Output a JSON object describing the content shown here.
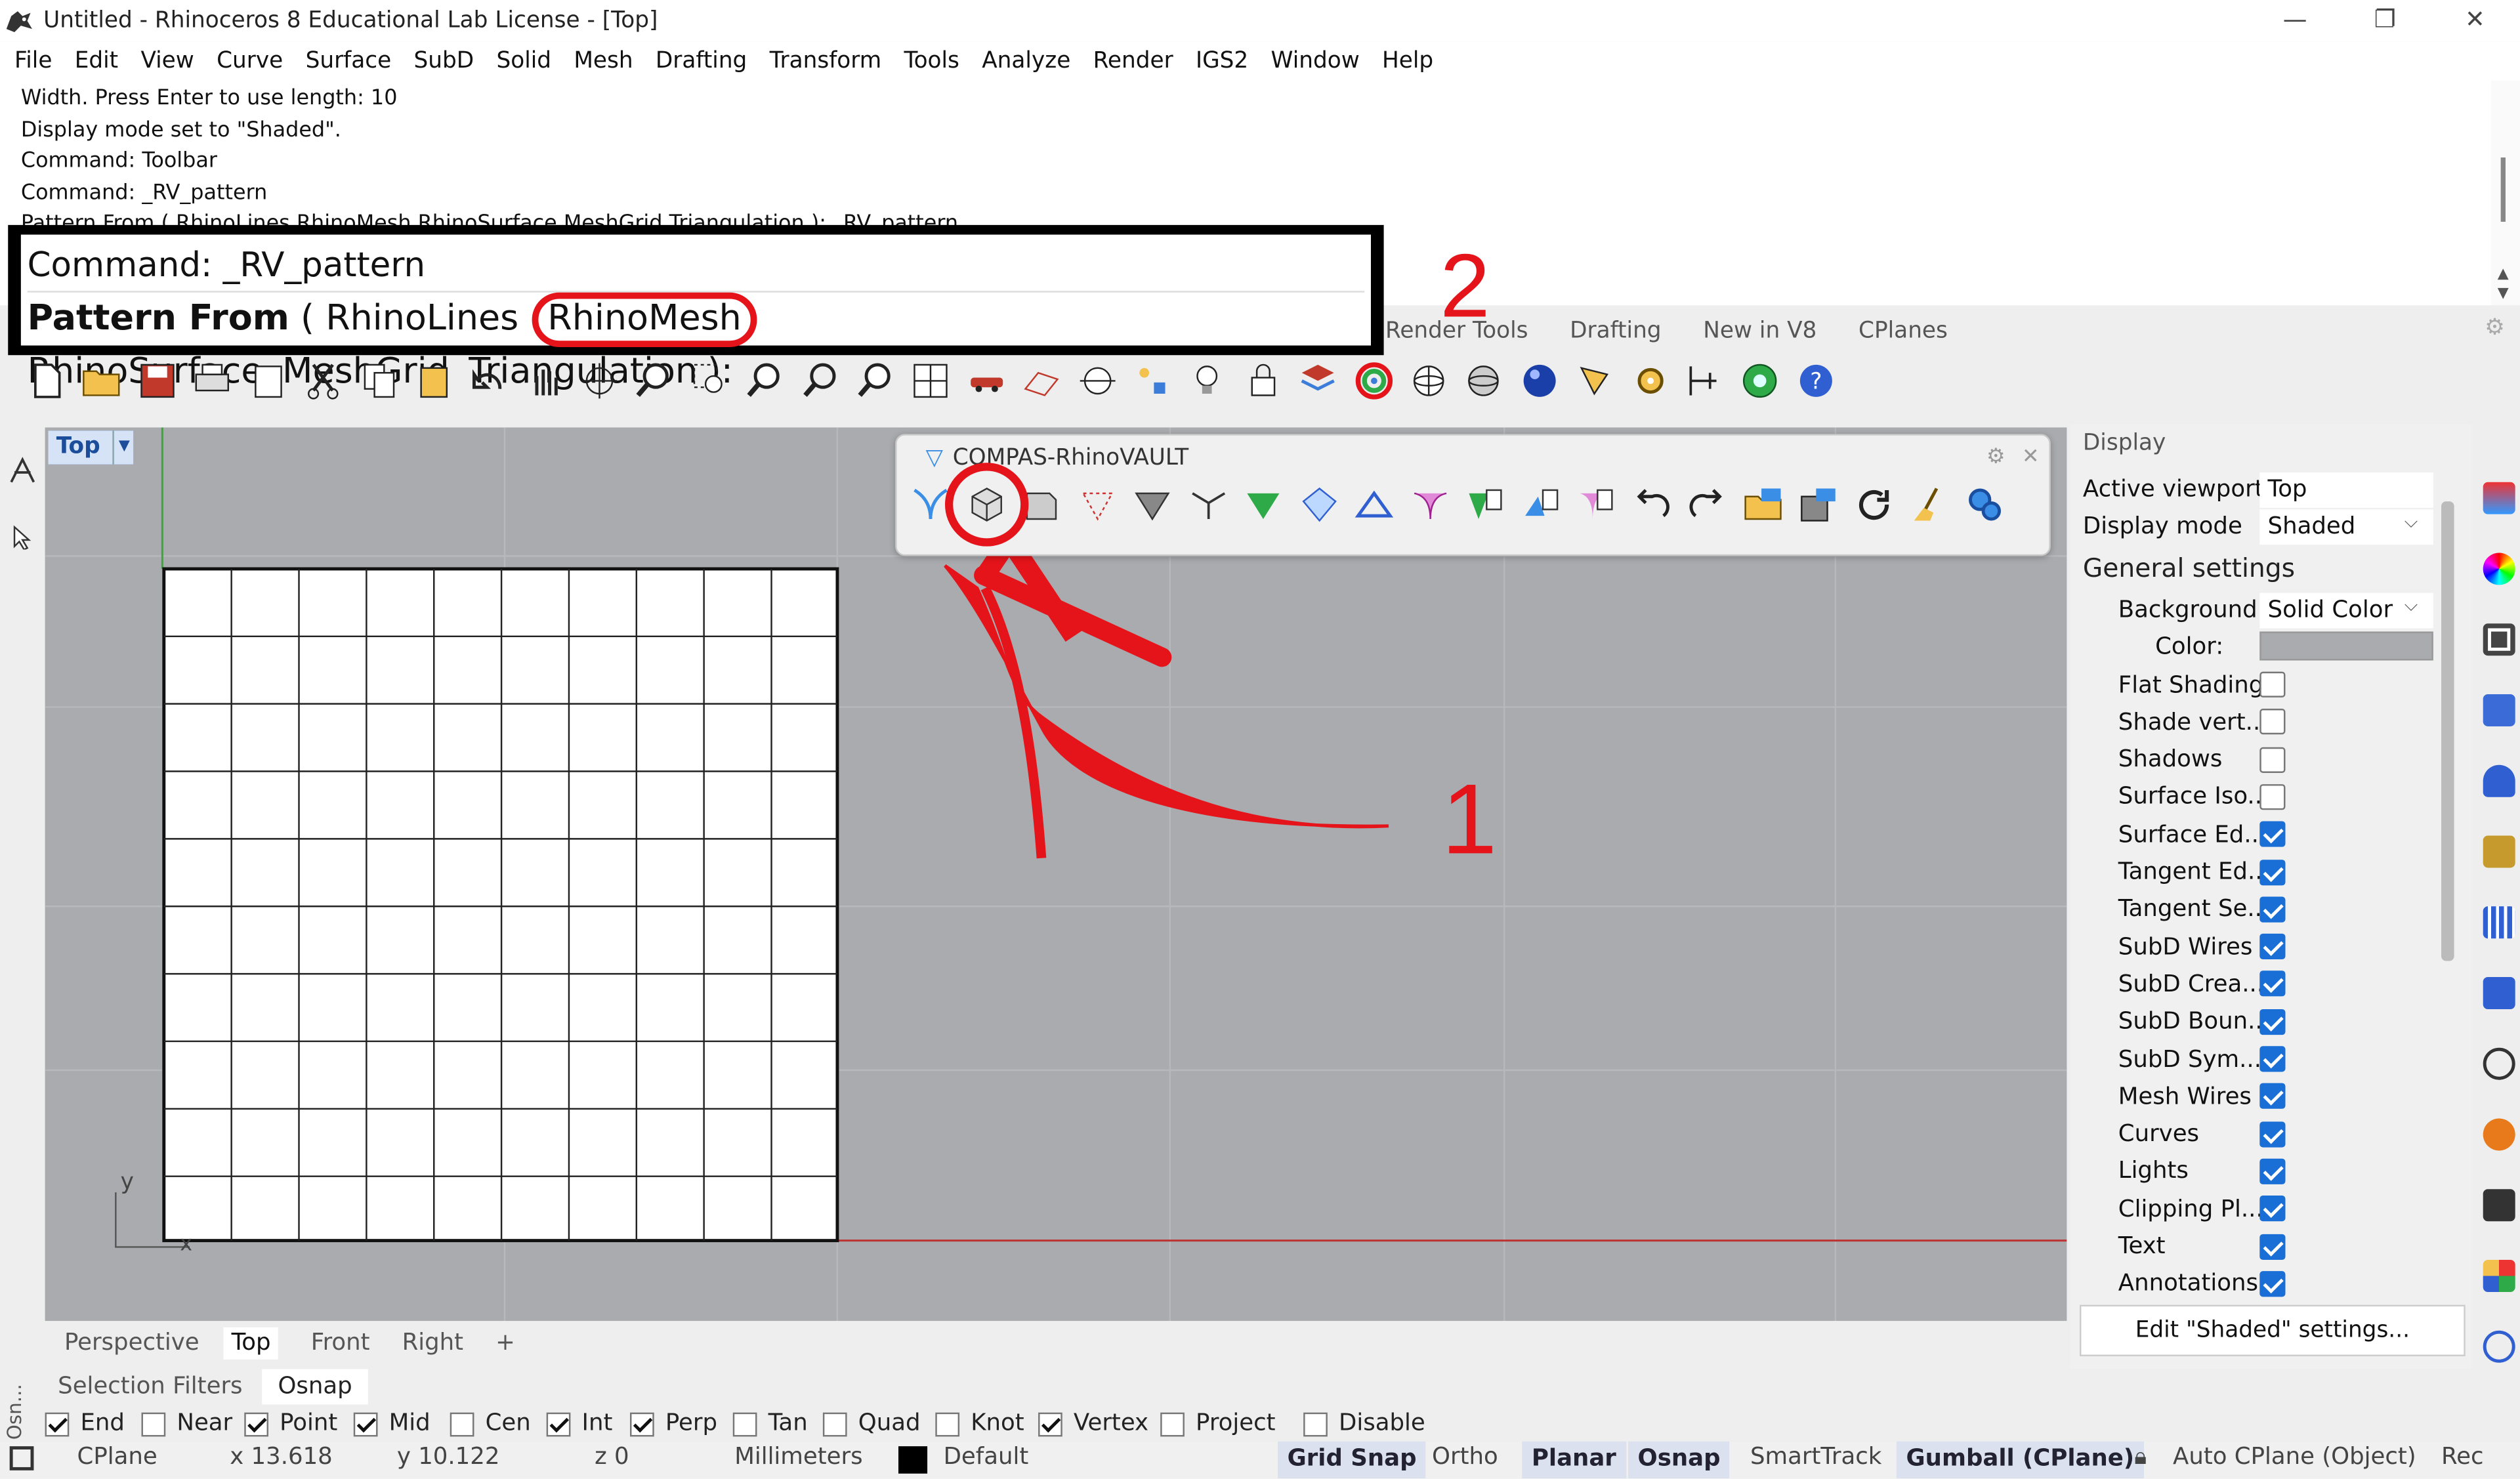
{
  "window": {
    "title": "Untitled - Rhinoceros 8 Educational Lab License - [Top]",
    "minimize": "—",
    "restore": "❐",
    "close": "✕"
  },
  "menu": [
    "File",
    "Edit",
    "View",
    "Curve",
    "Surface",
    "SubD",
    "Solid",
    "Mesh",
    "Drafting",
    "Transform",
    "Tools",
    "Analyze",
    "Render",
    "IGS2",
    "Window",
    "Help"
  ],
  "history": [
    "Width. Press Enter to use length: 10",
    "Display mode set to \"Shaded\".",
    "Command: Toolbar",
    "Command: _RV_pattern",
    "Pattern From ( RhinoLines  RhinoMesh  RhinoSurface  MeshGrid  Triangulation ):  _RV_pattern"
  ],
  "command": {
    "line1": "Command: _RV_pattern",
    "prompt_bold": "Pattern From",
    "paren_open": "(",
    "options": [
      "RhinoLines",
      "RhinoMesh",
      "RhinoSurface",
      "MeshGrid",
      "Triangulation"
    ],
    "suffix": "):"
  },
  "annotations": {
    "step1": "1",
    "step2": "2",
    "color": "#e5141b"
  },
  "toolbar_tabs": [
    "Render Tools",
    "Drafting",
    "New in V8",
    "CPlanes"
  ],
  "viewport": {
    "name": "Top",
    "axis_y": "y",
    "axis_x": "x",
    "grid_color": "#b8babd",
    "bg": "#a9abae"
  },
  "rhinovault": {
    "title": "COMPAS-RhinoVAULT"
  },
  "display_panel": {
    "header": "Display",
    "active_viewport_label": "Active viewport",
    "active_viewport": "Top",
    "display_mode_label": "Display mode",
    "display_mode": "Shaded",
    "general_settings": "General settings",
    "background_label": "Background",
    "background": "Solid Color",
    "color_label": "Color:",
    "settings": [
      {
        "label": "Flat Shading",
        "checked": false
      },
      {
        "label": "Shade vert...",
        "checked": false
      },
      {
        "label": "Shadows",
        "checked": false
      },
      {
        "label": "Surface Iso...",
        "checked": false
      },
      {
        "label": "Surface Ed...",
        "checked": true
      },
      {
        "label": "Tangent Ed...",
        "checked": true
      },
      {
        "label": "Tangent Se...",
        "checked": true
      },
      {
        "label": "SubD Wires",
        "checked": true
      },
      {
        "label": "SubD Crea...",
        "checked": true
      },
      {
        "label": "SubD Boun...",
        "checked": true
      },
      {
        "label": "SubD Sym...",
        "checked": true
      },
      {
        "label": "Mesh Wires",
        "checked": true
      },
      {
        "label": "Curves",
        "checked": true
      },
      {
        "label": "Lights",
        "checked": true
      },
      {
        "label": "Clipping Pl...",
        "checked": true
      },
      {
        "label": "Text",
        "checked": true
      },
      {
        "label": "Annotations",
        "checked": true
      }
    ],
    "edit_button": "Edit \"Shaded\" settings..."
  },
  "viewport_tabs": [
    "Perspective",
    "Top",
    "Front",
    "Right",
    "+"
  ],
  "panel_tabs": [
    "Selection Filters",
    "Osnap"
  ],
  "osnap_side": "Osn...",
  "osnaps": [
    {
      "label": "End",
      "checked": true
    },
    {
      "label": "Near",
      "checked": false
    },
    {
      "label": "Point",
      "checked": true
    },
    {
      "label": "Mid",
      "checked": true
    },
    {
      "label": "Cen",
      "checked": false
    },
    {
      "label": "Int",
      "checked": true
    },
    {
      "label": "Perp",
      "checked": true
    },
    {
      "label": "Tan",
      "checked": false
    },
    {
      "label": "Quad",
      "checked": false
    },
    {
      "label": "Knot",
      "checked": false
    },
    {
      "label": "Vertex",
      "checked": true
    },
    {
      "label": "Project",
      "checked": false
    },
    {
      "label": "Disable",
      "checked": false
    }
  ],
  "status": {
    "cplane": "CPlane",
    "x": "x 13.618",
    "y": "y 10.122",
    "z": "z 0",
    "units": "Millimeters",
    "layer": "Default",
    "grid_snap": "Grid Snap",
    "ortho": "Ortho",
    "planar": "Planar",
    "osnap": "Osnap",
    "smarttrack": "SmartTrack",
    "gumball": "Gumball (CPlane)",
    "autocplane": "Auto CPlane (Object)",
    "rec": "Rec"
  }
}
